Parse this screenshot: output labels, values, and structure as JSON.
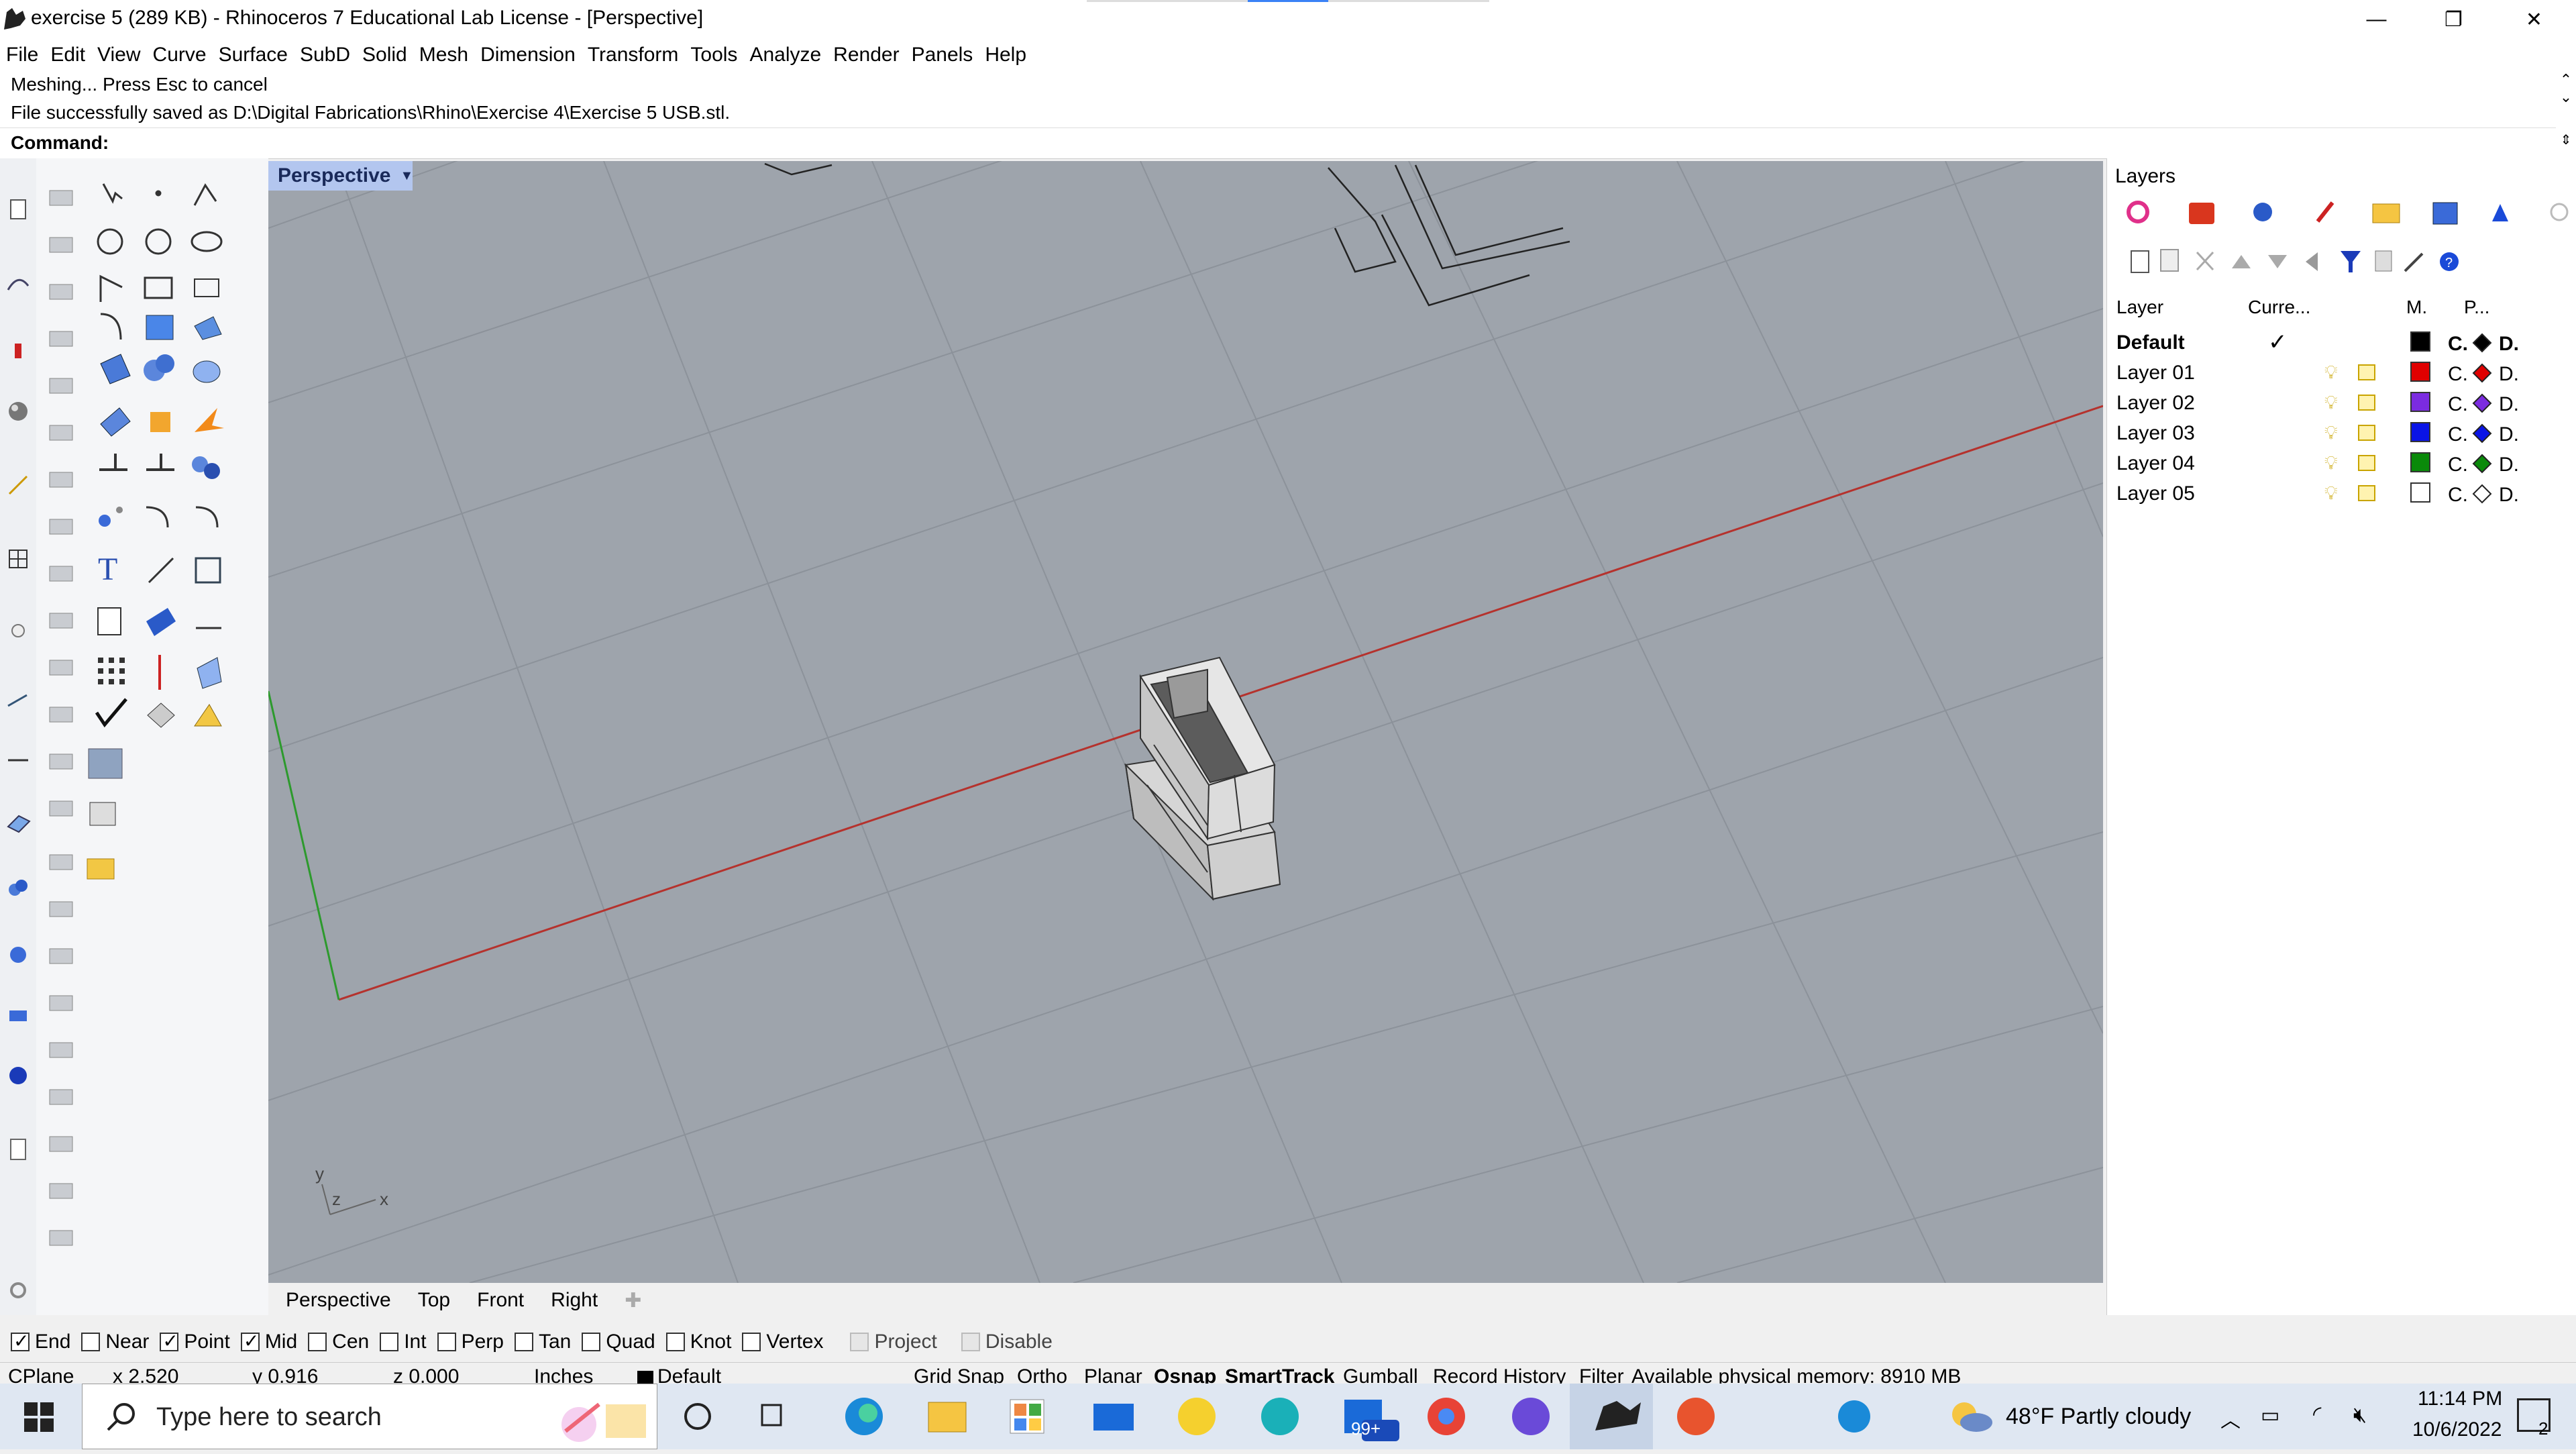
{
  "window": {
    "title": "exercise 5 (289 KB) - Rhinoceros 7 Educational Lab License - [Perspective]",
    "minimize_icon": "minimize-icon",
    "restore_icon": "restore-icon",
    "close_icon": "close-icon"
  },
  "menu": [
    "File",
    "Edit",
    "View",
    "Curve",
    "Surface",
    "SubD",
    "Solid",
    "Mesh",
    "Dimension",
    "Transform",
    "Tools",
    "Analyze",
    "Render",
    "Panels",
    "Help"
  ],
  "command_history": [
    "Meshing... Press Esc to cancel",
    "File successfully saved as D:\\Digital Fabrications\\Rhino\\Exercise 4\\Exercise 5 USB.stl."
  ],
  "command_prompt": "Command:",
  "viewport": {
    "active_label": "Perspective",
    "axis_labels": {
      "y": "y",
      "z": "z",
      "x": "x"
    }
  },
  "viewport_tabs": [
    "Perspective",
    "Top",
    "Front",
    "Right"
  ],
  "layers_panel": {
    "title": "Layers",
    "columns": {
      "layer": "Layer",
      "current": "Curre...",
      "material": "M.",
      "print": "P..."
    },
    "rows": [
      {
        "name": "Default",
        "current": "✓",
        "color": "#000000",
        "linetype": "C.",
        "print": "D.",
        "print_color": "#000000",
        "bold": true
      },
      {
        "name": "Layer 01",
        "current": "",
        "color": "#e00000",
        "linetype": "C.",
        "print": "D.",
        "print_color": "#e00000"
      },
      {
        "name": "Layer 02",
        "current": "",
        "color": "#7b2be0",
        "linetype": "C.",
        "print": "D.",
        "print_color": "#7b2be0"
      },
      {
        "name": "Layer 03",
        "current": "",
        "color": "#0a14e6",
        "linetype": "C.",
        "print": "D.",
        "print_color": "#0a14e6"
      },
      {
        "name": "Layer 04",
        "current": "",
        "color": "#0a8a0a",
        "linetype": "C.",
        "print": "D.",
        "print_color": "#0a8a0a"
      },
      {
        "name": "Layer 05",
        "current": "",
        "color": "#ffffff",
        "linetype": "C.",
        "print": "D.",
        "print_color": "#ffffff"
      }
    ]
  },
  "osnaps": [
    {
      "label": "End",
      "checked": true
    },
    {
      "label": "Near",
      "checked": false
    },
    {
      "label": "Point",
      "checked": true
    },
    {
      "label": "Mid",
      "checked": true
    },
    {
      "label": "Cen",
      "checked": false
    },
    {
      "label": "Int",
      "checked": false
    },
    {
      "label": "Perp",
      "checked": false
    },
    {
      "label": "Tan",
      "checked": false
    },
    {
      "label": "Quad",
      "checked": false
    },
    {
      "label": "Knot",
      "checked": false
    },
    {
      "label": "Vertex",
      "checked": false
    },
    {
      "label": "Project",
      "checked": false,
      "disabled": true
    },
    {
      "label": "Disable",
      "checked": false,
      "disabled": true
    }
  ],
  "status": {
    "cplane": "CPlane",
    "x": "x 2.520",
    "y": "y 0.916",
    "z": "z 0.000",
    "units": "Inches",
    "layer": "Default",
    "grid_snap": "Grid Snap",
    "ortho": "Ortho",
    "planar": "Planar",
    "osnap": "Osnap",
    "smarttrack": "SmartTrack",
    "gumball": "Gumball",
    "record_history": "Record History",
    "filter": "Filter",
    "memory": "Available physical memory: 8910 MB"
  },
  "taskbar": {
    "search_placeholder": "Type here to search",
    "weather": "48°F  Partly cloudy",
    "time": "11:14 PM",
    "date": "10/6/2022",
    "mail_badge": "99+",
    "notification_count": "2"
  },
  "colors": {
    "viewport_bg": "#9ea4ac",
    "x_axis": "#c0302a",
    "y_axis": "#2aa02a",
    "tab_active": "#b3c6ef"
  }
}
